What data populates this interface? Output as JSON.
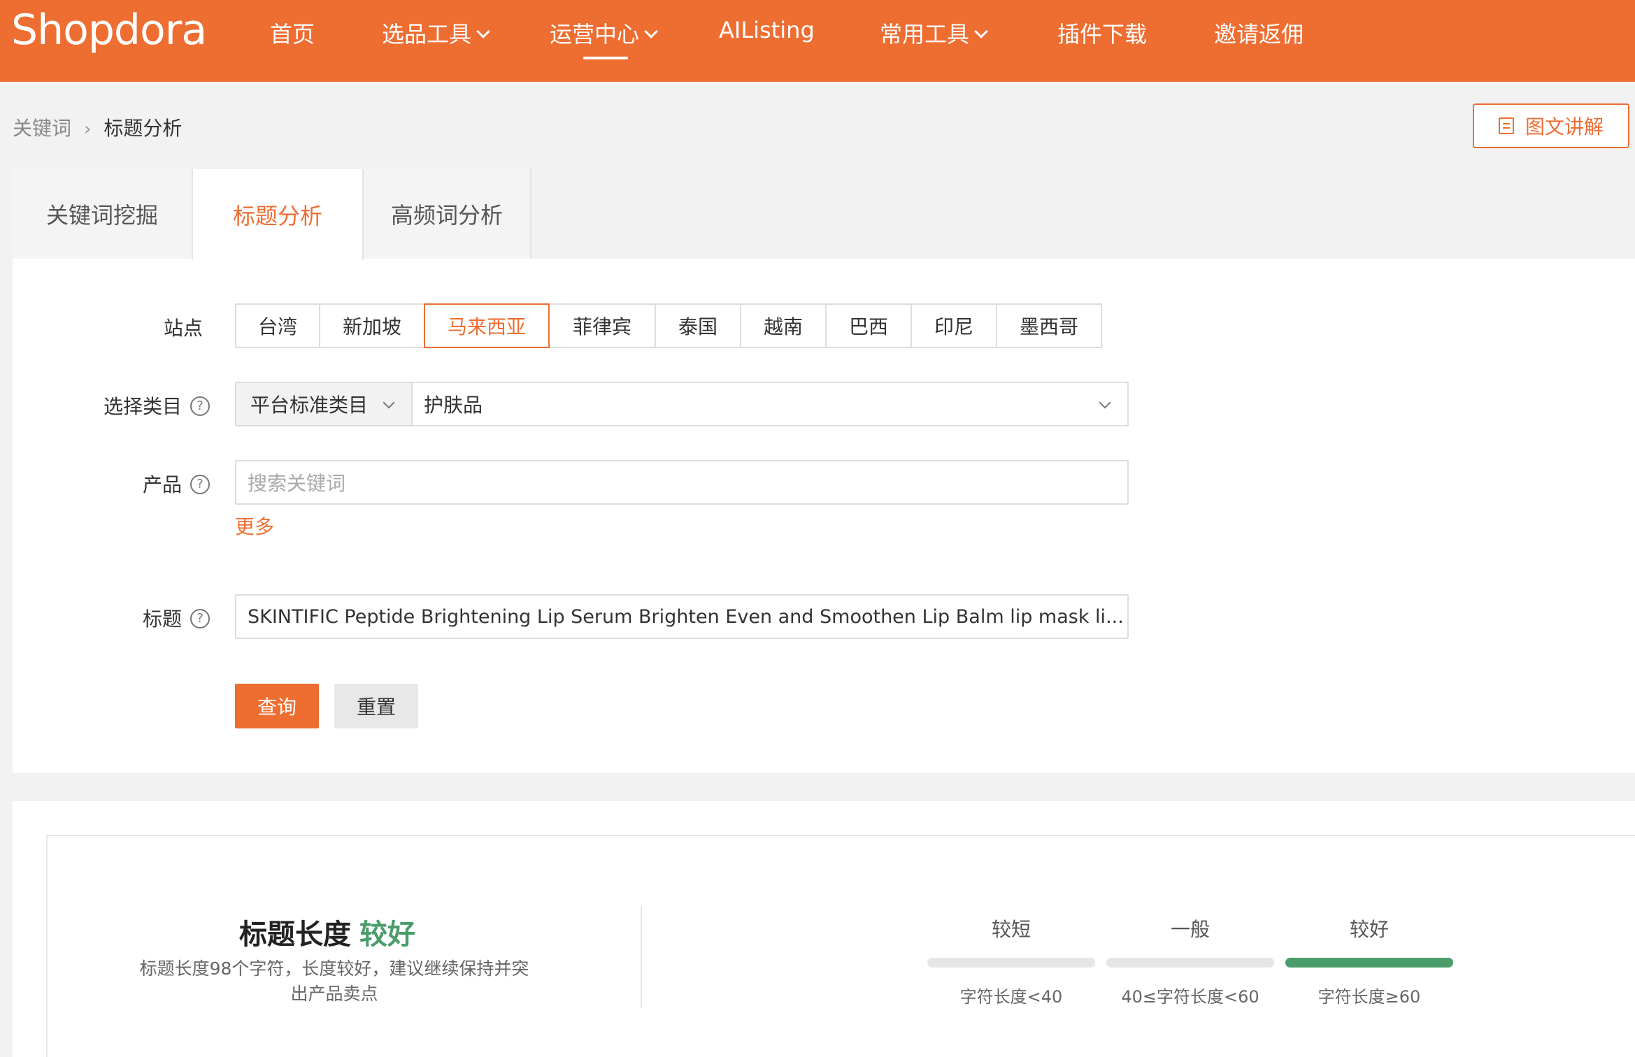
{
  "brand": {
    "logo": "Shopdora"
  },
  "nav": {
    "items": [
      {
        "label": "首页",
        "has_dropdown": false
      },
      {
        "label": "选品工具",
        "has_dropdown": true
      },
      {
        "label": "运营中心",
        "has_dropdown": true,
        "active": true
      },
      {
        "label": "AIListing",
        "has_dropdown": false
      },
      {
        "label": "常用工具",
        "has_dropdown": true
      },
      {
        "label": "插件下载",
        "has_dropdown": false
      },
      {
        "label": "邀请返佣",
        "has_dropdown": false
      }
    ]
  },
  "breadcrumb": {
    "parent": "关键词",
    "current": "标题分析"
  },
  "guide_button": {
    "label": "图文讲解"
  },
  "tabs": [
    {
      "label": "关键词挖掘",
      "active": false
    },
    {
      "label": "标题分析",
      "active": true
    },
    {
      "label": "高频词分析",
      "active": false
    }
  ],
  "form": {
    "site_label": "站点",
    "sites": [
      "台湾",
      "新加坡",
      "马来西亚",
      "菲律宾",
      "泰国",
      "越南",
      "巴西",
      "印尼",
      "墨西哥"
    ],
    "selected_site": "马来西亚",
    "category_label": "选择类目",
    "category_type": "平台标准类目",
    "category_value": "护肤品",
    "product_label": "产品",
    "product_placeholder": "搜索关键词",
    "more_link": "更多",
    "title_label": "标题",
    "title_value": "SKINTIFIC Peptide Brightening Lip Serum Brighten Even and Smoothen Lip Balm lip mask li...",
    "query_button": "查询",
    "reset_button": "重置",
    "help_icon_glyph": "?"
  },
  "result": {
    "heading": "标题长度",
    "rating": "较好",
    "description": "标题长度98个字符，长度较好，建议继续保持并突出产品卖点",
    "scale": [
      {
        "label": "较短",
        "range": "字符长度<40",
        "active": false
      },
      {
        "label": "一般",
        "range": "40≤字符长度<60",
        "active": false
      },
      {
        "label": "较好",
        "range": "字符长度≥60",
        "active": true
      }
    ]
  },
  "colors": {
    "brand": "#ee6d31",
    "good": "#4a9d6a"
  }
}
